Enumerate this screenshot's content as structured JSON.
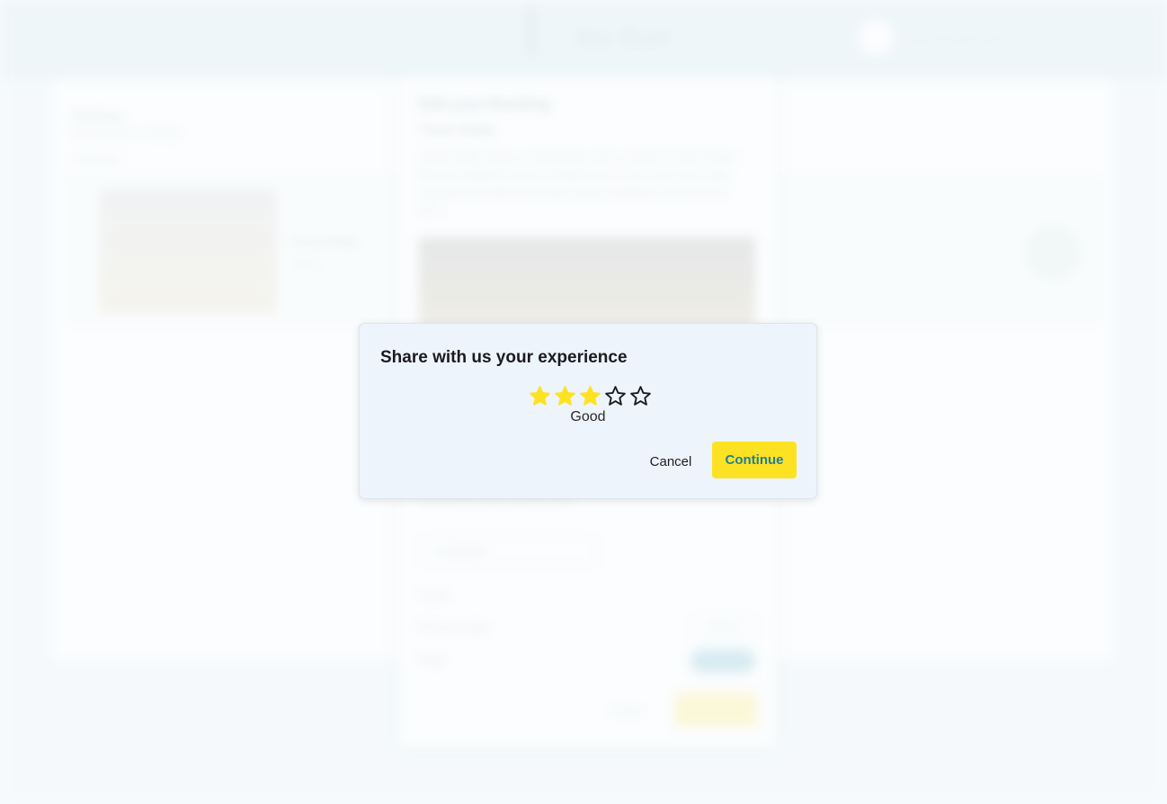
{
  "background": {
    "brand_name": "Go Sun",
    "user_name": "Sandra Klug Huber",
    "page_heading": "Bookings",
    "page_sub": "Manage your bookings",
    "meta": "1 booking",
    "listing_title": "Tourist Sittling",
    "listing_line": "3 days"
  },
  "panel": {
    "title": "Edit your Booking",
    "name": "Tiwuk Sittlay",
    "description": "Tourist Sittlay lends an intimate life craft in located in Tourist Sittlay. We set established accommodation to all the mind stay mornings, and guests benefit from private parking available on site and free WiFi.",
    "link": "Tap here for more rules for more",
    "select_value": "Completed",
    "costs_label": "Costs",
    "price_label": "Price per day",
    "price_value": "€60.00",
    "total_label": "Total",
    "close_label": "Close",
    "save_label": "Save"
  },
  "modal": {
    "title": "Share with us your experience",
    "rating": 3,
    "max_rating": 5,
    "rating_label": "Good",
    "cancel_label": "Cancel",
    "continue_label": "Continue"
  },
  "colors": {
    "accent_yellow": "#fde224",
    "star_filled": "#fde224",
    "star_outline": "#1b1b1f",
    "continue_text": "#1f7f95",
    "modal_bg": "#eef4fc"
  }
}
